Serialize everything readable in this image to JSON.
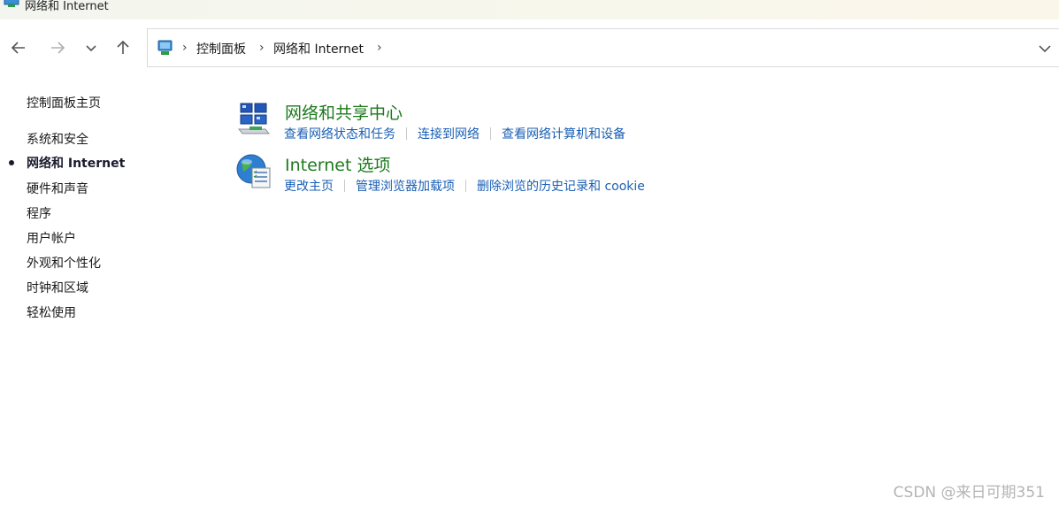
{
  "window": {
    "title": "网络和 Internet",
    "icon": "control-panel-icon"
  },
  "nav": {
    "back_icon": "arrow-left-icon",
    "forward_icon": "arrow-right-icon",
    "recent_icon": "chevron-down-icon",
    "up_icon": "arrow-up-icon"
  },
  "address": {
    "location_icon": "control-panel-icon",
    "crumbs": [
      "控制面板",
      "网络和 Internet"
    ],
    "separator": "›",
    "dropdown_icon": "chevron-down-icon"
  },
  "sidebar": {
    "home": "控制面板主页",
    "items": [
      {
        "label": "系统和安全",
        "current": false
      },
      {
        "label": "网络和 Internet",
        "current": true
      },
      {
        "label": "硬件和声音",
        "current": false
      },
      {
        "label": "程序",
        "current": false
      },
      {
        "label": "用户帐户",
        "current": false
      },
      {
        "label": "外观和个性化",
        "current": false
      },
      {
        "label": "时钟和区域",
        "current": false
      },
      {
        "label": "轻松使用",
        "current": false
      }
    ]
  },
  "categories": [
    {
      "title": "网络和共享中心",
      "icon": "network-sharing-center-icon",
      "links": [
        "查看网络状态和任务",
        "连接到网络",
        "查看网络计算机和设备"
      ]
    },
    {
      "title": "Internet 选项",
      "icon": "internet-options-icon",
      "links": [
        "更改主页",
        "管理浏览器加载项",
        "删除浏览的历史记录和 cookie"
      ]
    }
  ],
  "watermark": "CSDN @来日可期351",
  "colors": {
    "category_title": "#1e7a1e",
    "link": "#1a5fb4",
    "text": "#1a1a1a"
  }
}
